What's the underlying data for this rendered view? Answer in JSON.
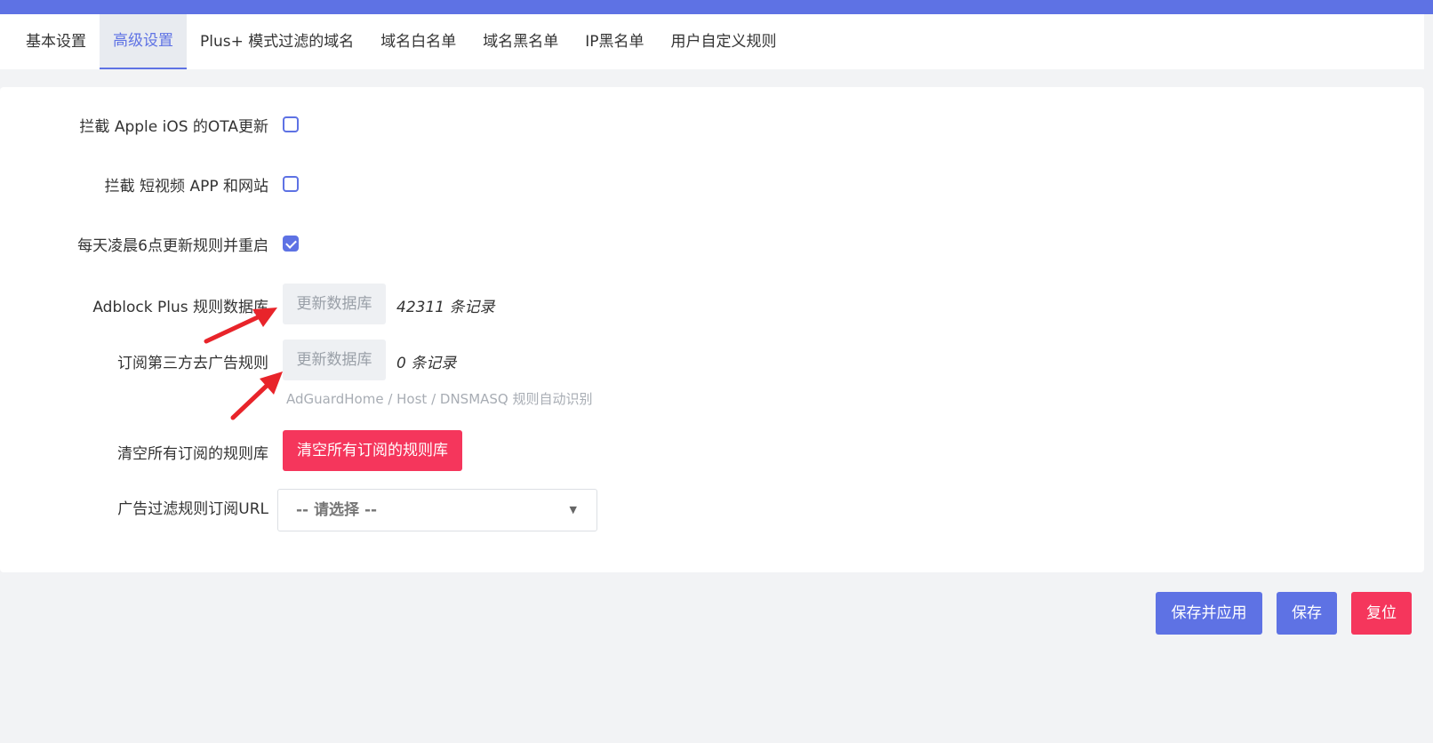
{
  "tabs": [
    {
      "label": "基本设置"
    },
    {
      "label": "高级设置"
    },
    {
      "label": "Plus+ 模式过滤的域名"
    },
    {
      "label": "域名白名单"
    },
    {
      "label": "域名黑名单"
    },
    {
      "label": "IP黑名单"
    },
    {
      "label": "用户自定义规则"
    }
  ],
  "active_tab": "高级设置",
  "settings": {
    "block_ios_ota": {
      "label": "拦截 Apple iOS 的OTA更新",
      "checked": false
    },
    "block_short_video": {
      "label": "拦截 短视频 APP 和网站",
      "checked": false
    },
    "daily_update": {
      "label": "每天凌晨6点更新规则并重启",
      "checked": true
    },
    "adblock_db": {
      "label": "Adblock Plus 规则数据库",
      "button": "更新数据库",
      "count": "42311 条记录"
    },
    "third_party": {
      "label": "订阅第三方去广告规则",
      "button": "更新数据库",
      "count": "0 条记录",
      "hint": "AdGuardHome / Host / DNSMASQ 规则自动识别"
    },
    "clear_all": {
      "label": "清空所有订阅的规则库",
      "button": "清空所有订阅的规则库"
    },
    "subscribe_url": {
      "label": "广告过滤规则订阅URL",
      "value": "-- 请选择 --"
    }
  },
  "footer": {
    "save_apply": "保存并应用",
    "save": "保存",
    "reset": "复位"
  },
  "colors": {
    "accent": "#5e72e4",
    "danger": "#f5365c",
    "annotation_arrow": "#e8242a"
  }
}
